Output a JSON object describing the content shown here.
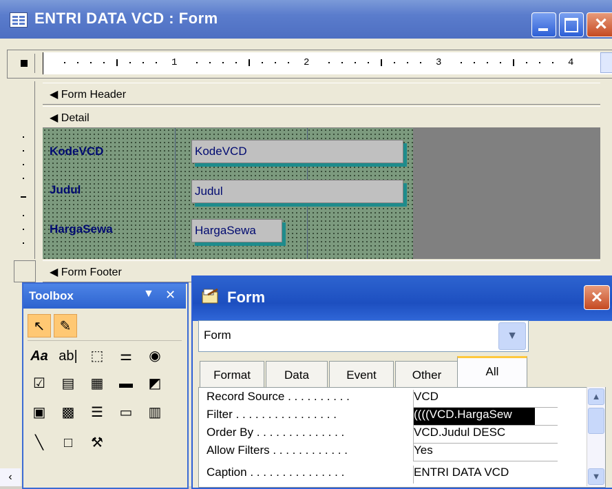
{
  "window": {
    "title": "ENTRI DATA VCD : Form"
  },
  "ruler": {
    "numbers": [
      "1",
      "2",
      "3",
      "4"
    ]
  },
  "sections": {
    "form_header": "Form Header",
    "detail": "Detail",
    "form_footer": "Form Footer"
  },
  "detail_fields": [
    {
      "label": "KodeVCD",
      "control": "KodeVCD"
    },
    {
      "label": "Judul",
      "control": "Judul"
    },
    {
      "label": "HargaSewa",
      "control": "HargaSewa"
    }
  ],
  "toolbox": {
    "title": "Toolbox"
  },
  "properties": {
    "title": "Form",
    "selector_value": "Form",
    "tabs": [
      "Format",
      "Data",
      "Event",
      "Other",
      "All"
    ],
    "active_tab": "All",
    "rows": [
      {
        "name": "Record Source . . . . . . . . . .",
        "value": "VCD"
      },
      {
        "name": "Filter . . . . . . . . . . . . . . . .",
        "value": "((((VCD.HargaSew"
      },
      {
        "name": "Order By . . . . . . . . . . . . . .",
        "value": "VCD.Judul DESC"
      },
      {
        "name": "Allow Filters . . . . . . . . . . . .",
        "value": "Yes"
      },
      {
        "name": "Caption . . . . . . . . . . . . . . .",
        "value": "ENTRI DATA VCD"
      }
    ]
  },
  "colors": {
    "title_bar": "#4e6fc2",
    "label_text": "#000a70",
    "detail_background": "#7c9a7e",
    "textbox_shadow": "#1e8c8c",
    "selected_tool": "#ffc873"
  }
}
